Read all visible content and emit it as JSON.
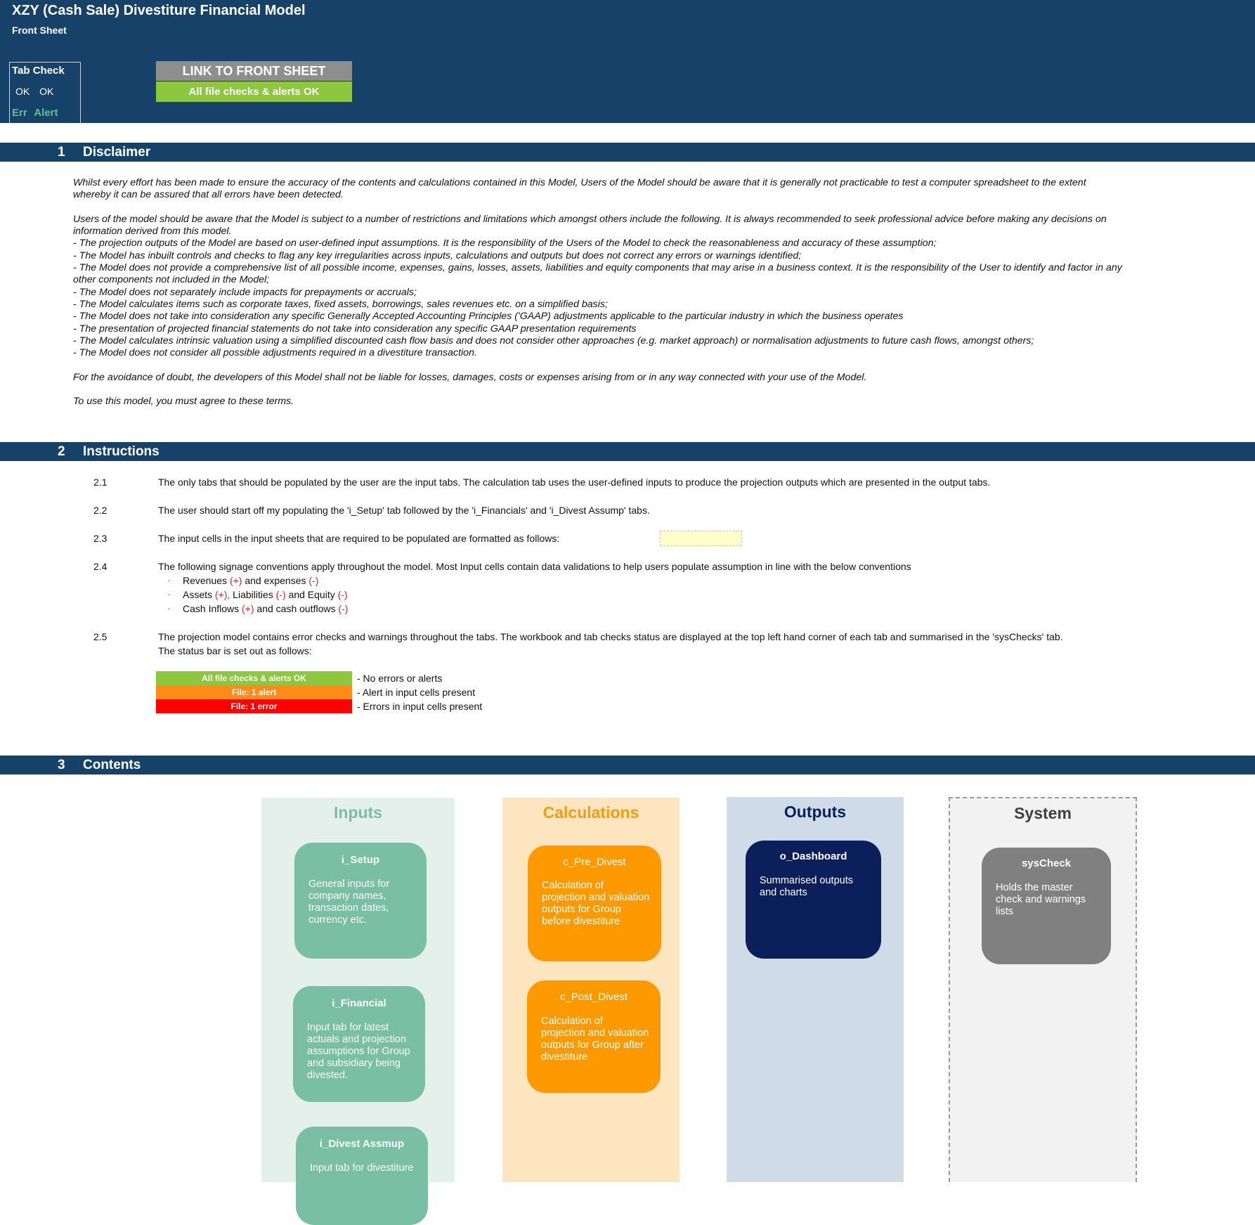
{
  "header": {
    "title": "XZY (Cash Sale) Divestiture Financial Model",
    "subtitle": "Front Sheet",
    "tab_check": {
      "heading": "Tab Check",
      "ok_row": "OK OK",
      "err_row": "Err Alert"
    },
    "link_button": "LINK TO FRONT SHEET",
    "status": "All file checks & alerts OK"
  },
  "sections": [
    {
      "num": "1",
      "label": "Disclaimer"
    },
    {
      "num": "2",
      "label": "Instructions"
    },
    {
      "num": "3",
      "label": "Contents"
    }
  ],
  "disclaimer": {
    "p1": "Whilst every effort has been made to ensure the accuracy of the contents and calculations contained in this Model, Users of the Model should be aware that it is generally not practicable to test a computer spreadsheet to the extent whereby it can be assured that all errors have been detected.",
    "p2": "Users of the model should be aware that the Model is subject to a number of restrictions and limitations which amongst others include the following. It is always recommended to seek professional advice before making any decisions on information derived from this model.",
    "items": [
      "- The projection outputs of the Model are based on user-defined input assumptions. It is the responsibility of the Users of the Model to check the reasonableness and accuracy of these assumption;",
      "- The Model has inbuilt controls and checks to flag any key irregularities across inputs, calculations and outputs but does not correct any errors or warnings identified;",
      "- The Model does not provide a comprehensive list of all possible income, expenses, gains, losses, assets, liabilities and equity components that may arise in a business context. It is the responsibility of the User to identify and factor in any other components not included in the Model;",
      "- The Model does not separately include impacts for prepayments or accruals;",
      "- The Model calculates items such as corporate taxes, fixed assets, borrowings, sales revenues etc. on a simplified basis;",
      "- The Model does not take into consideration any specific Generally Accepted Accounting Principles ('GAAP) adjustments applicable to the particular industry in which the business operates",
      "- The presentation of projected financial statements do not take into consideration any specific GAAP presentation requirements",
      "- The Model calculates intrinsic valuation using a simplified discounted cash flow basis and does not consider other approaches (e.g. market approach) or normalisation adjustments to future cash flows, amongst others;",
      "- The Model does not consider all possible adjustments required in a divestiture transaction."
    ],
    "p3": "For the avoidance of doubt, the developers of this Model shall not be liable for losses, damages, costs or expenses arising from or in any way connected with your use of the Model.",
    "p4": "To use this model, you must agree to these terms."
  },
  "instructions": {
    "i1": {
      "num": "2.1",
      "text": "The only tabs that should be populated by the user are the input tabs. The calculation tab uses the user-defined inputs to produce the projection outputs which are presented in the output tabs."
    },
    "i2": {
      "num": "2.2",
      "text": "The user should start off my populating the 'i_Setup' tab followed by the 'i_Financials' and 'i_Divest Assump' tabs."
    },
    "i3": {
      "num": "2.3",
      "text": "The input cells in the input sheets that are required to be populated are formatted as follows:"
    },
    "i4": {
      "num": "2.4",
      "text": "The following signage conventions apply throughout the model. Most Input cells contain data validations to help users populate assumption in line with the below conventions"
    },
    "bullet_char": "·",
    "b1": {
      "a": "Revenues ",
      "s1": "(+)",
      "b": " and expenses ",
      "s2": "(-)"
    },
    "b2": {
      "a": "Assets ",
      "s1": "(+),",
      "b": " Liabilities ",
      "s2": "(-)",
      "c": " and Equity ",
      "s3": "(-)"
    },
    "b3": {
      "a": "Cash Inflows ",
      "s1": "(+)",
      "b": " and cash outflows ",
      "s2": "(-)"
    },
    "i5": {
      "num": "2.5",
      "text": "The projection model contains error checks and warnings throughout the tabs. The workbook and tab checks status are displayed at the top left hand corner of each tab and summarised in the 'sysChecks' tab.",
      "text2": "The status bar is set out as follows:"
    },
    "status_rows": [
      {
        "label": "All file checks & alerts OK",
        "legend": "- No errors or alerts",
        "color": "#8dc63f"
      },
      {
        "label": "File: 1 alert",
        "legend": "- Alert in input cells present",
        "color": "#ff8c1a"
      },
      {
        "label": "File: 1 error",
        "legend": "- Errors in input cells present",
        "color": "#ff0000"
      }
    ]
  },
  "contents": {
    "inputs": {
      "heading": "Inputs",
      "cards": [
        {
          "title": "i_Setup",
          "desc": "General inputs for company names, transaction dates, currency etc."
        },
        {
          "title": "i_Financial",
          "desc": "Input tab for latest actuals and projection assumptions for Group and subsidiary being divested."
        },
        {
          "title": "i_Divest Assmup",
          "desc": "Input tab for divestiture"
        }
      ]
    },
    "calculations": {
      "heading": "Calculations",
      "cards": [
        {
          "title": "c_Pre_Divest",
          "desc": "Calculation of projection and valuation outputs for Group before divestiture"
        },
        {
          "title": "c_Post_Divest",
          "desc": "Calculation of projection and valuation outputs for Group after divestiture"
        }
      ]
    },
    "outputs": {
      "heading": "Outputs",
      "cards": [
        {
          "title": "o_Dashboard",
          "desc": "Summarised outputs and charts"
        }
      ]
    },
    "system": {
      "heading": "System",
      "cards": [
        {
          "title": "sysCheck",
          "desc": "Holds the master check and warnings lists"
        }
      ]
    }
  },
  "colors": {
    "header_bg": "#16426a",
    "inputs_panel": "#e3f0ec",
    "inputs_card": "#78bfa5",
    "inputs_head": "#78bfa5",
    "calc_panel": "#fde6bf",
    "calc_card": "#ff9900",
    "calc_head": "#f39c12",
    "outputs_panel": "#cfdbe6",
    "outputs_card": "#0b1f5c",
    "outputs_head": "#0b1f5c",
    "system_panel": "#f2f2f2",
    "system_card": "#808080",
    "system_head": "#404040"
  }
}
